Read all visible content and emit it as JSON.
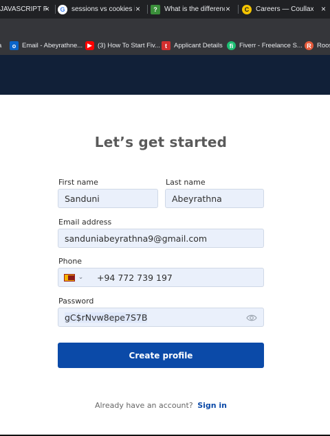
{
  "browser": {
    "tabs": [
      {
        "title": "JAVASCRIPT F",
        "icon": "doc-icon"
      },
      {
        "title": "sessions vs cookies ir",
        "icon": "google-icon"
      },
      {
        "title": "What is the differenc",
        "icon": "site-icon"
      },
      {
        "title": "Careers — Coullax",
        "icon": "coullax-icon"
      }
    ],
    "close_glyph": "×",
    "bookmarks": [
      {
        "label": "Email - Abeyrathne...",
        "icon": "outlook-icon",
        "color": "#0a64c8"
      },
      {
        "label": "(3) How To Start Fiv...",
        "icon": "youtube-icon",
        "color": "#ff0000"
      },
      {
        "label": "Applicant Details",
        "icon": "applicant-icon",
        "color": "#d32f2f"
      },
      {
        "label": "Fiverr - Freelance S...",
        "icon": "fiverr-icon",
        "color": "#1dbf73"
      },
      {
        "label": "Roost",
        "icon": "roost-icon",
        "color": "#e45a3b"
      }
    ]
  },
  "header": {
    "bg_color": "#112038"
  },
  "form": {
    "title": "Let’s get started",
    "first_name": {
      "label": "First name",
      "value": "Sanduni"
    },
    "last_name": {
      "label": "Last name",
      "value": "Abeyrathna"
    },
    "email": {
      "label": "Email address",
      "value": "sanduniabeyrathna9@gmail.com"
    },
    "phone": {
      "label": "Phone",
      "value": "+94 772 739 197",
      "country_flag": "sri-lanka-flag-icon"
    },
    "password": {
      "label": "Password",
      "value": "gC$rNvw8epe7S7B"
    },
    "submit_label": "Create profile",
    "accent_color": "#0b4aa8"
  },
  "footer": {
    "prompt": "Already have an account?",
    "link": "Sign in"
  }
}
